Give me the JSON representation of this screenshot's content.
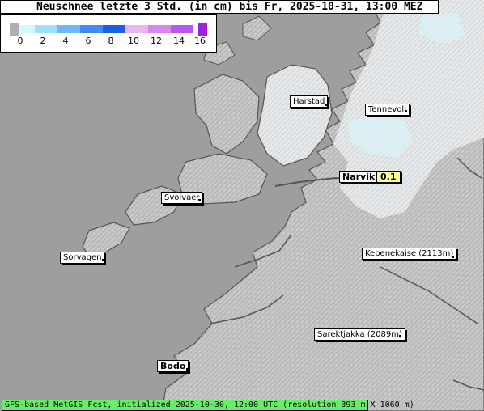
{
  "title": "Neuschnee letzte 3 Std. (in cm) bis Fr, 2025-10-31, 13:00 MEZ",
  "legend": {
    "ticks": [
      "0",
      "2",
      "4",
      "6",
      "8",
      "10",
      "12",
      "14",
      "16"
    ],
    "colors": [
      "#b0b0b0",
      "#cff8ff",
      "#9fe0ff",
      "#6fb8ff",
      "#3f8cf2",
      "#1c5ee0",
      "#e9b6f0",
      "#d688ee",
      "#bb55ee",
      "#9922dd"
    ]
  },
  "places": [
    {
      "name": "Harstad"
    },
    {
      "name": "Tennevoll"
    },
    {
      "name": "Narvik",
      "value": "0.1"
    },
    {
      "name": "Svolvaer"
    },
    {
      "name": "Sorvagen"
    },
    {
      "name": "Kebenekaise (2113m)"
    },
    {
      "name": "Sarektjakka (2089m)"
    },
    {
      "name": "Bodo"
    }
  ],
  "footer": "GFS-based MetGIS Fcst, initialized 2025-10-30, 12:00 UTC  (resolution 393 m X 1060 m)",
  "colors": {
    "sea": "#9e9e9e",
    "land": "#c8c8c8",
    "snow": "#eef2f4",
    "new_snow_light": "#d8f4fa",
    "footer_bg": "#66ee66",
    "value_bg": "#ffff99"
  }
}
